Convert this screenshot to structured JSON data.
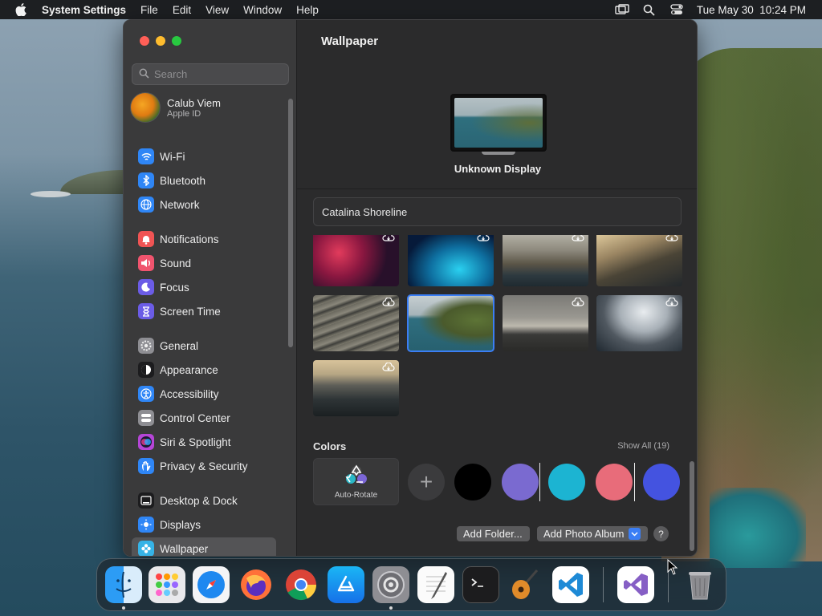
{
  "menubar": {
    "app_name": "System Settings",
    "items": [
      "File",
      "Edit",
      "View",
      "Window",
      "Help"
    ],
    "clock": "Tue May 30  10:24 PM"
  },
  "sidebar": {
    "search_placeholder": "Search",
    "account": {
      "name": "Calub Viem",
      "subtitle": "Apple ID"
    },
    "items": [
      {
        "label": "Wi-Fi",
        "icon": "wifi-icon",
        "color": "#2f86f6"
      },
      {
        "label": "Bluetooth",
        "icon": "bluetooth-icon",
        "color": "#2f86f6"
      },
      {
        "label": "Network",
        "icon": "globe-icon",
        "color": "#2f86f6"
      },
      {
        "label": "Notifications",
        "icon": "bell-icon",
        "color": "#f05454"
      },
      {
        "label": "Sound",
        "icon": "speaker-icon",
        "color": "#f0546e"
      },
      {
        "label": "Focus",
        "icon": "moon-icon",
        "color": "#6b5ce6"
      },
      {
        "label": "Screen Time",
        "icon": "hourglass-icon",
        "color": "#6b5ce6"
      },
      {
        "label": "General",
        "icon": "gear-icon",
        "color": "#8e8e93"
      },
      {
        "label": "Appearance",
        "icon": "appearance-icon",
        "color": "#1c1c1e"
      },
      {
        "label": "Accessibility",
        "icon": "accessibility-icon",
        "color": "#2f86f6"
      },
      {
        "label": "Control Center",
        "icon": "toggles-icon",
        "color": "#8e8e93"
      },
      {
        "label": "Siri & Spotlight",
        "icon": "siri-icon",
        "color": "#b545d6"
      },
      {
        "label": "Privacy & Security",
        "icon": "hand-icon",
        "color": "#2f86f6"
      },
      {
        "label": "Desktop & Dock",
        "icon": "dock-icon",
        "color": "#1c1c1e"
      },
      {
        "label": "Displays",
        "icon": "sun-icon",
        "color": "#2f86f6"
      },
      {
        "label": "Wallpaper",
        "icon": "flower-icon",
        "color": "#36b3e6"
      }
    ],
    "selected": "Wallpaper"
  },
  "main": {
    "title": "Wallpaper",
    "display_name": "Unknown Display",
    "wallpaper_name": "Catalina Shoreline",
    "colors_heading": "Colors",
    "show_all": "Show All (19)",
    "auto_rotate_label": "Auto-Rotate",
    "swatches": [
      "#000000",
      "#7a6ad0",
      "#1cb4d2",
      "#e86c7a",
      "#4453e0"
    ],
    "add_folder": "Add Folder...",
    "add_photo_album": "Add Photo Album",
    "help": "?"
  },
  "dock": {
    "apps": [
      "Finder",
      "Launchpad",
      "Safari",
      "Firefox",
      "Chrome",
      "App Store",
      "System Settings",
      "TextEdit",
      "Terminal",
      "GarageBand",
      "Visual Studio Code",
      "Visual Studio",
      "Trash"
    ]
  }
}
